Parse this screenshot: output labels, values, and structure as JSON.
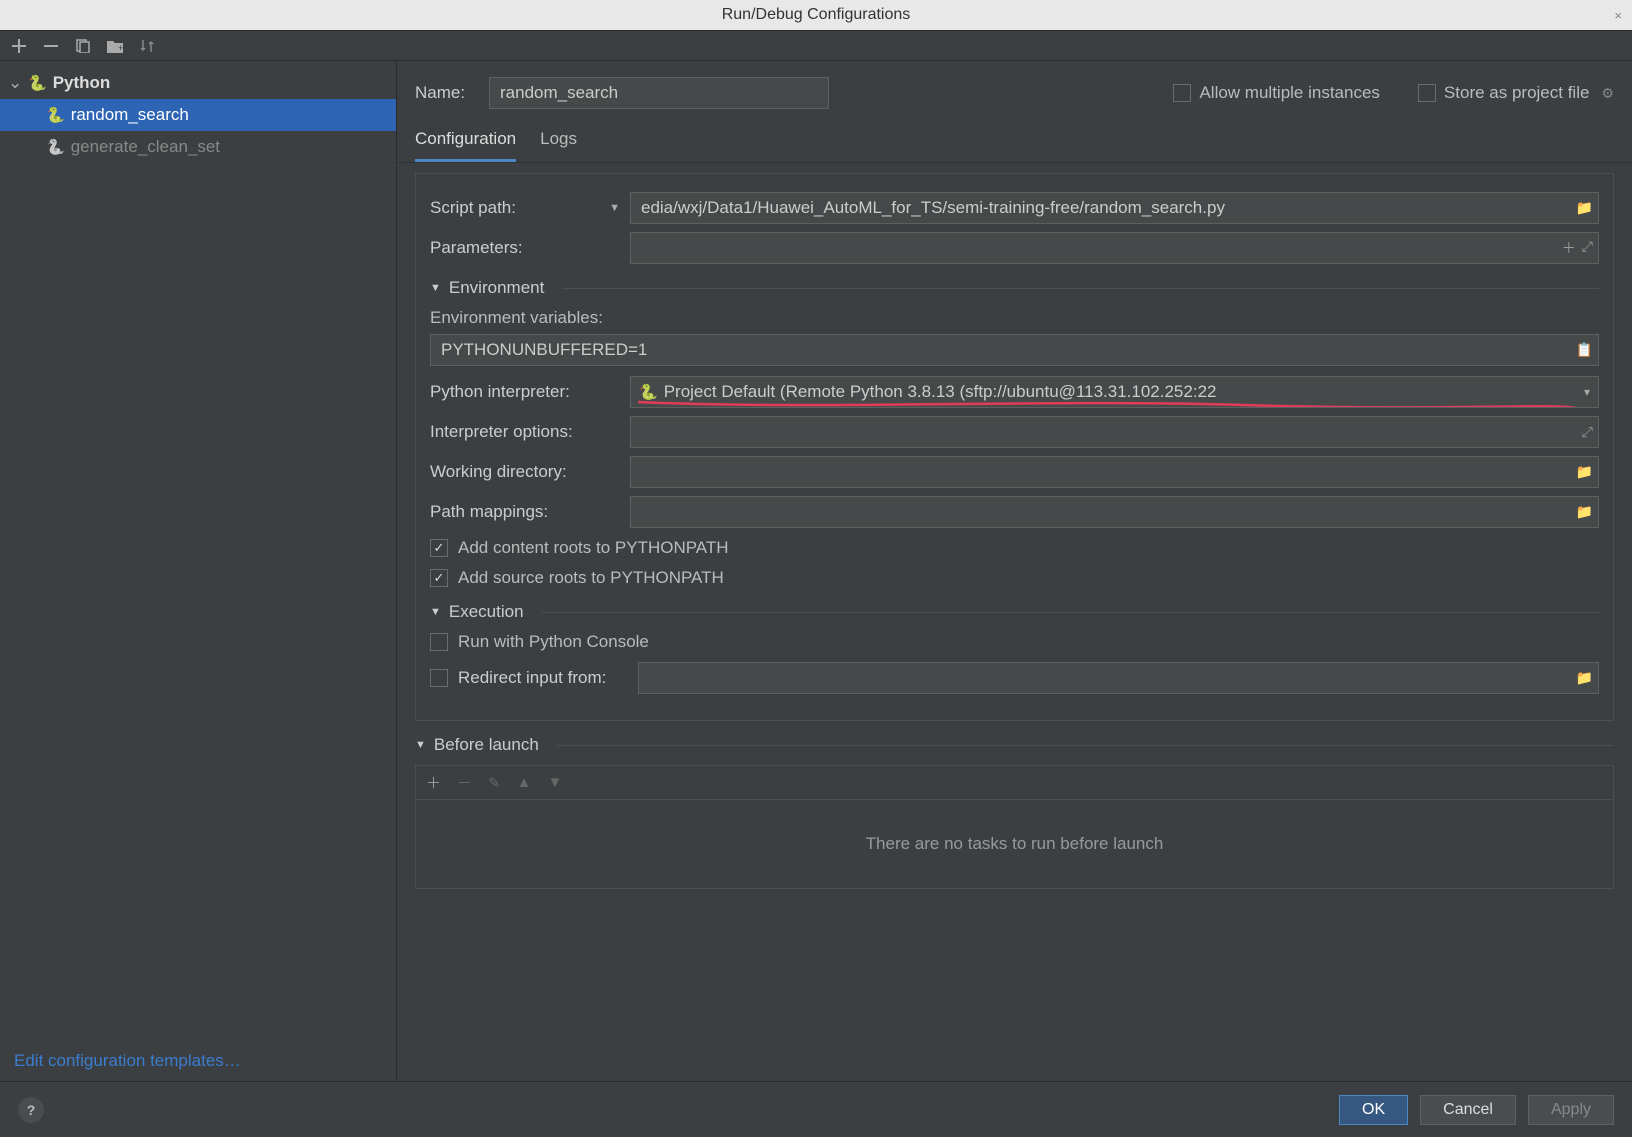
{
  "window": {
    "title": "Run/Debug Configurations"
  },
  "sidebar": {
    "group": "Python",
    "items": [
      {
        "label": "random_search",
        "selected": true
      },
      {
        "label": "generate_clean_set",
        "selected": false
      }
    ],
    "edit_templates": "Edit configuration templates…"
  },
  "header": {
    "name_label": "Name:",
    "name_value": "random_search",
    "allow_multiple": "Allow multiple instances",
    "store_as_project": "Store as project file"
  },
  "tabs": {
    "configuration": "Configuration",
    "logs": "Logs"
  },
  "form": {
    "script_path_label": "Script path:",
    "script_path_value": "edia/wxj/Data1/Huawei_AutoML_for_TS/semi-training-free/random_search.py",
    "parameters_label": "Parameters:",
    "parameters_value": "",
    "environment_header": "Environment",
    "env_vars_label": "Environment variables:",
    "env_vars_value": "PYTHONUNBUFFERED=1",
    "interpreter_label": "Python interpreter:",
    "interpreter_value": "Project Default (Remote Python 3.8.13 (sftp://ubuntu@113.31.102.252:22",
    "interpreter_options_label": "Interpreter options:",
    "interpreter_options_value": "",
    "working_dir_label": "Working directory:",
    "working_dir_value": "",
    "path_mappings_label": "Path mappings:",
    "path_mappings_value": "",
    "add_content_roots": "Add content roots to PYTHONPATH",
    "add_source_roots": "Add source roots to PYTHONPATH",
    "execution_header": "Execution",
    "run_python_console": "Run with Python Console",
    "redirect_input_label": "Redirect input from:",
    "redirect_input_value": "",
    "before_launch_header": "Before launch",
    "no_tasks": "There are no tasks to run before launch"
  },
  "buttons": {
    "ok": "OK",
    "cancel": "Cancel",
    "apply": "Apply"
  },
  "icons": {
    "add": "＋",
    "remove": "－",
    "copy": "⧉",
    "folder_add": "📁",
    "sort": "↓↑",
    "chevron_down": "▾",
    "folder": "📁",
    "expand": "⤢",
    "list": "☰",
    "plus": "＋",
    "minus": "－",
    "edit": "✎",
    "up": "▲",
    "down": "▼"
  }
}
